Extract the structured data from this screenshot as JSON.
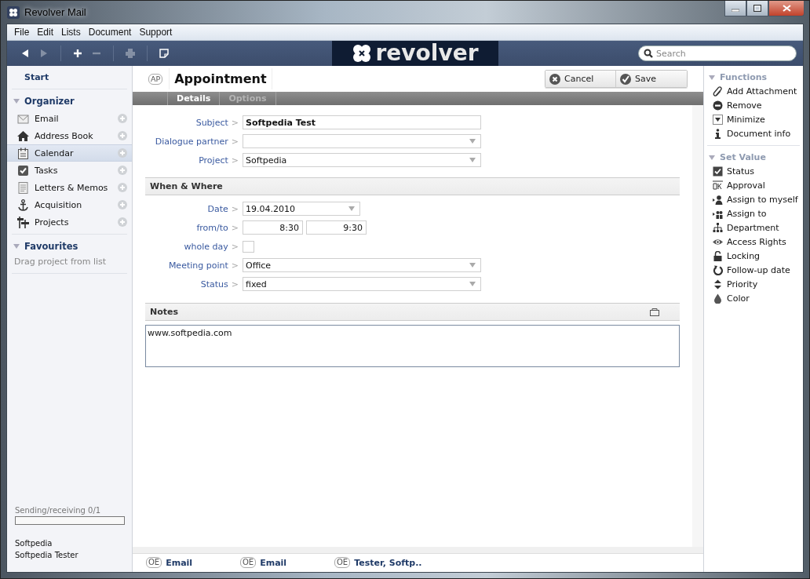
{
  "window": {
    "title": "Revolver Mail"
  },
  "menu": [
    "File",
    "Edit",
    "Lists",
    "Document",
    "Support"
  ],
  "toolbar": [
    {
      "disabled": false
    },
    {
      "disabled": true
    },
    {
      "disabled": false
    },
    {
      "disabled": true
    },
    {
      "disabled": true
    },
    {
      "disabled": false
    }
  ],
  "logo": "revolver",
  "search": {
    "placeholder": "Search"
  },
  "sidebar": {
    "start": "Start",
    "organizer": {
      "title": "Organizer",
      "items": [
        {
          "label": "Email",
          "selected": false
        },
        {
          "label": "Address Book",
          "selected": false
        },
        {
          "label": "Calendar",
          "selected": true
        },
        {
          "label": "Tasks",
          "selected": false
        },
        {
          "label": "Letters & Memos",
          "selected": false
        },
        {
          "label": "Acquisition",
          "selected": false
        },
        {
          "label": "Projects",
          "selected": false
        }
      ]
    },
    "favourites": {
      "title": "Favourites",
      "hint": "Drag project from list"
    },
    "sync": {
      "label": "Sending/receiving 0/1",
      "level": 0
    },
    "account": [
      "Softpedia",
      "Softpedia Tester"
    ]
  },
  "document": {
    "badge": "AP",
    "title": "Appointment",
    "buttons": [
      "Cancel",
      "Save"
    ],
    "tabs": [
      {
        "label": "Details",
        "selected": true
      },
      {
        "label": "Options",
        "selected": false
      }
    ],
    "fields": [
      {
        "kind": "text",
        "label": "Subject",
        "separator": ">",
        "value": "Softpedia Test"
      },
      {
        "kind": "select",
        "label": "Dialogue partner",
        "separator": ">"
      },
      {
        "kind": "select",
        "label": "Project",
        "separator": ">",
        "value": "Softpedia"
      }
    ],
    "when_where": {
      "title": "When & Where",
      "fields": [
        {
          "kind": "date",
          "label": "Date",
          "separator": ">",
          "value": "19.04.2010"
        },
        {
          "kind": "range",
          "label": "from/to",
          "separator": ">",
          "values": [
            "8:30",
            "9:30"
          ]
        },
        {
          "kind": "checkbox",
          "label": "whole day",
          "separator": ">",
          "checked": false
        },
        {
          "kind": "select",
          "label": "Meeting point",
          "separator": ">",
          "value": "Office"
        },
        {
          "kind": "select",
          "label": "Status",
          "separator": ">",
          "value": "fixed"
        }
      ]
    },
    "notes": {
      "title": "Notes",
      "value": "www.softpedia.com"
    }
  },
  "bottom_tabs": [
    {
      "badge": "OE",
      "label": "Email"
    },
    {
      "badge": "OE",
      "label": "Email"
    },
    {
      "badge": "OE",
      "label": "Tester, Softp.."
    }
  ],
  "actions": [
    {
      "title": "Functions",
      "items": [
        "Add Attachment",
        "Remove",
        "Minimize",
        "Document info"
      ]
    },
    {
      "title": "Set Value",
      "items": [
        "Status",
        "Approval",
        "Assign to myself",
        "Assign to",
        "Department",
        "Access Rights",
        "Locking",
        "Follow-up date",
        "Priority",
        "Color"
      ]
    }
  ]
}
